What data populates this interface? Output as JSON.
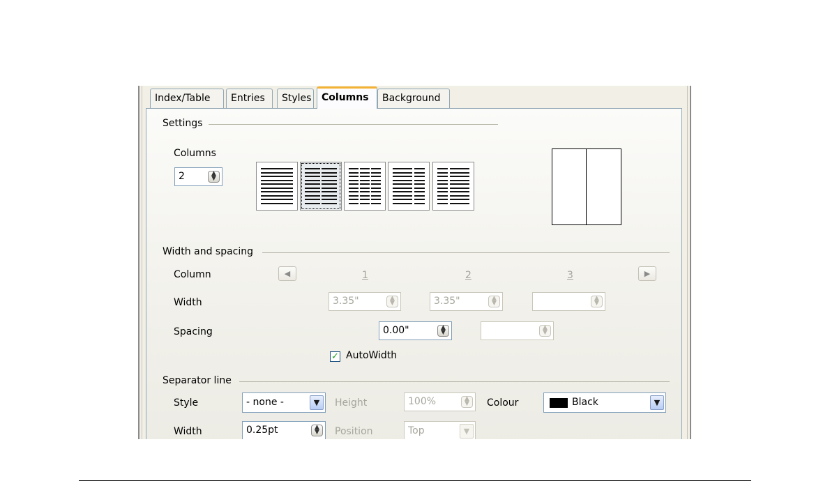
{
  "tabs": [
    {
      "label": "Index/Table"
    },
    {
      "label": "Entries"
    },
    {
      "label": "Styles"
    },
    {
      "label": "Columns"
    },
    {
      "label": "Background"
    }
  ],
  "active_tab": "Columns",
  "settings": {
    "group_label": "Settings",
    "columns_label": "Columns",
    "columns_value": "2",
    "selected_layout": 2
  },
  "width_spacing": {
    "group_label": "Width and spacing",
    "column_label": "Column",
    "column_numbers": [
      "1",
      "2",
      "3"
    ],
    "width_label": "Width",
    "widths": [
      "3.35\"",
      "3.35\"",
      ""
    ],
    "spacing_label": "Spacing",
    "spacings": [
      "0.00\"",
      ""
    ],
    "autowidth_label": "AutoWidth",
    "autowidth_checked": true
  },
  "separator": {
    "group_label": "Separator line",
    "style_label": "Style",
    "style_value": "- none -",
    "height_label": "Height",
    "height_value": "100%",
    "colour_label": "Colour",
    "colour_value": "Black",
    "colour_swatch": "#000000",
    "width_label": "Width",
    "width_value": "0.25pt",
    "position_label": "Position",
    "position_value": "Top"
  },
  "colors": {
    "active_tab_accent": "#f4b234",
    "dialog_bg": "#f1efe6"
  }
}
